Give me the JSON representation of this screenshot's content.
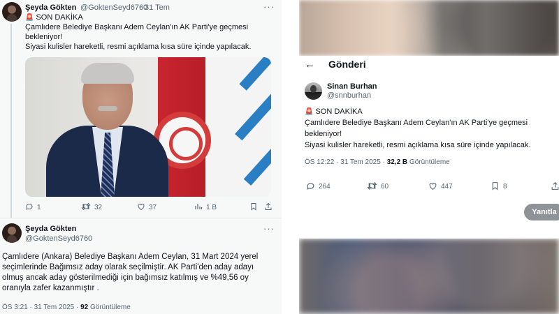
{
  "left": {
    "tweet1": {
      "name": "Şeyda Gökten",
      "handle": "@GoktenSeyd6760",
      "sep": "·",
      "date": "31 Tem",
      "more": "···",
      "line1": "SON DAKİKA",
      "line2": "Çamlıdere Belediye Başkanı Adem Ceylan'ın AK Parti'ye geçmesi",
      "line3": "bekleniyor!",
      "line4": "Siyasi kulisler hareketli, resmi açıklama kısa süre içinde yapılacak.",
      "actions": {
        "replies": "1",
        "retweets": "32",
        "likes": "37",
        "views": "1 B"
      }
    },
    "tweet2": {
      "name": "Şeyda Gökten",
      "handle": "@GoktenSeyd6760",
      "more": "···",
      "line1": "Çamlıdere (Ankara) Belediye Başkanı Adem Ceylan, 31 Mart 2024 yerel",
      "line2": "seçimlerinde Bağımsız aday olarak seçilmiştir. AK Parti'den aday adayı",
      "line3": "olmuş ancak aday gösterilmediği için bağımsız katılmış ve %49,56 oy",
      "line4": "oranıyla zafer kazanmıştır .",
      "time": "ÖS 3:21 · 31 Tem 2025 ·",
      "views_count": "92",
      "views_label": "Görüntüleme"
    }
  },
  "right": {
    "header_title": "Gönderi",
    "name": "Sinan Burhan",
    "handle": "@snnburhan",
    "line1": "SON DAKİKA",
    "line2": "Çamlıdere Belediye Başkanı Adem Ceylan'ın AK Parti'ye geçmesi",
    "line3": "bekleniyor!",
    "line4": "Siyasi kulisler hareketli, resmi açıklama kısa süre içinde yapılacak.",
    "time": "ÖS 12:22 · 31 Tem 2025 ·",
    "views_count": "32,2 B",
    "views_label": "Görüntüleme",
    "actions": {
      "replies": "264",
      "retweets": "60",
      "likes": "447",
      "bookmarks": "8"
    },
    "reply_button": "Yanıtla"
  },
  "icons": {
    "siren": "rotating-light-icon",
    "reply": "comment-icon",
    "retweet": "retweet-icon",
    "like": "heart-icon",
    "views": "bar-chart-icon",
    "bookmark": "bookmark-icon",
    "share": "share-icon",
    "back": "arrow-left-icon"
  },
  "colors": {
    "text": "#0f1419",
    "muted": "#536471",
    "siren": "#e0245e",
    "reply_button": "#8e9398"
  }
}
